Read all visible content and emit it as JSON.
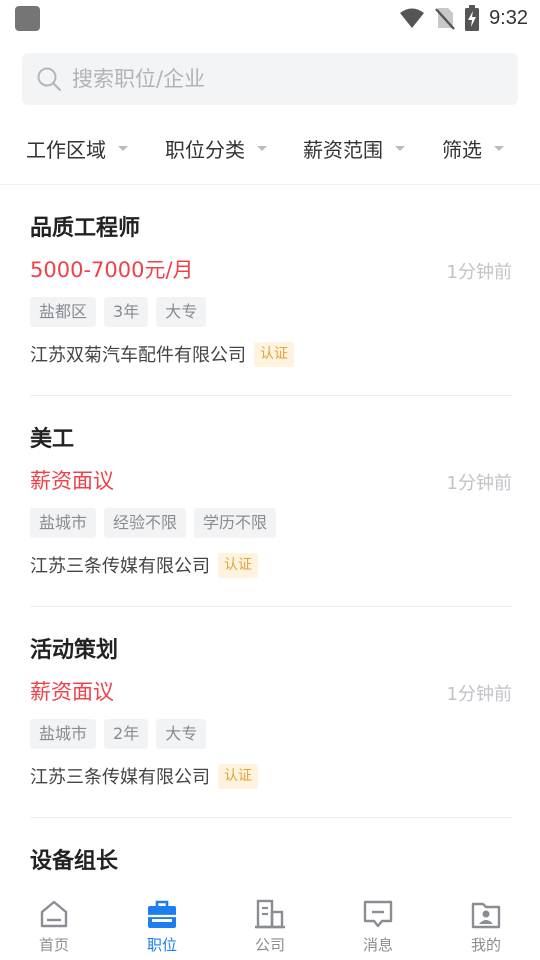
{
  "status_bar": {
    "time": "9:32"
  },
  "search": {
    "placeholder": "搜索职位/企业"
  },
  "filters": [
    "工作区域",
    "职位分类",
    "薪资范围",
    "筛选"
  ],
  "jobs": [
    {
      "title": "品质工程师",
      "salary": "5000-7000元/月",
      "time": "1分钟前",
      "tags": [
        "盐都区",
        "3年",
        "大专"
      ],
      "company": "江苏双菊汽车配件有限公司",
      "cert": "认证"
    },
    {
      "title": "美工",
      "salary": "薪资面议",
      "time": "1分钟前",
      "tags": [
        "盐城市",
        "经验不限",
        "学历不限"
      ],
      "company": "江苏三条传媒有限公司",
      "cert": "认证"
    },
    {
      "title": "活动策划",
      "salary": "薪资面议",
      "time": "1分钟前",
      "tags": [
        "盐城市",
        "2年",
        "大专"
      ],
      "company": "江苏三条传媒有限公司",
      "cert": "认证"
    },
    {
      "title": "设备组长"
    }
  ],
  "bottom_nav": [
    {
      "label": "首页",
      "icon": "home-icon",
      "active": false
    },
    {
      "label": "职位",
      "icon": "briefcase-icon",
      "active": true
    },
    {
      "label": "公司",
      "icon": "building-icon",
      "active": false
    },
    {
      "label": "消息",
      "icon": "message-icon",
      "active": false
    },
    {
      "label": "我的",
      "icon": "profile-icon",
      "active": false
    }
  ],
  "colors": {
    "accent": "#1c7ef0",
    "salary": "#f0414a",
    "cert_bg": "#fdf3de",
    "cert_text": "#e0a53c"
  }
}
